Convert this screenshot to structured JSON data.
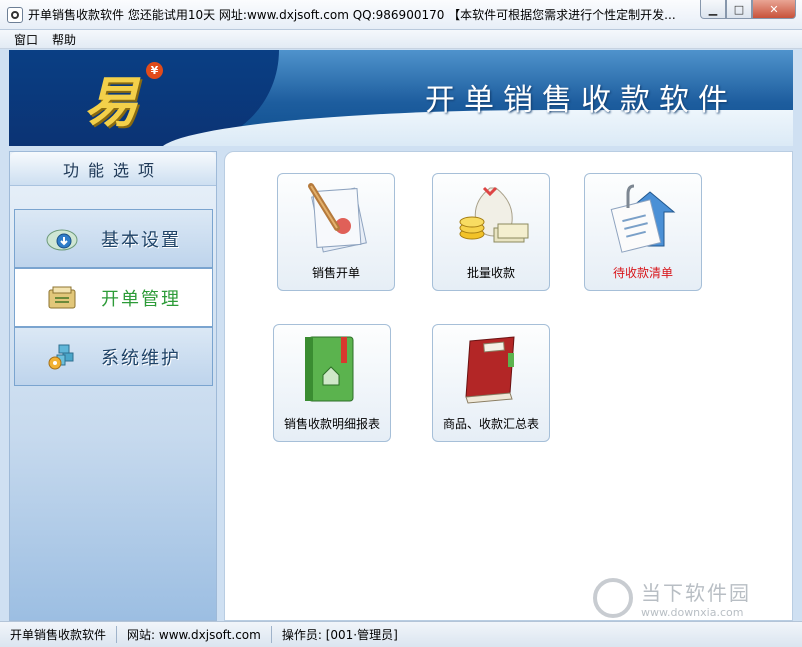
{
  "window": {
    "title": "开单销售收款软件  您还能试用10天   网址:www.dxjsoft.com   QQ:986900170   【本软件可根据您需求进行个性定制开发...",
    "minimize_symbol": "▁",
    "maximize_symbol": "□",
    "close_symbol": "✕"
  },
  "menu": [
    "窗口",
    "帮助"
  ],
  "banner": {
    "logo_text": "易",
    "logo_badge": "¥",
    "title": "开单销售收款软件"
  },
  "sidebar": {
    "header": "功能选项",
    "items": [
      {
        "label": "基本设置",
        "icon": "basic-settings-icon",
        "active": false
      },
      {
        "label": "开单管理",
        "icon": "order-management-icon",
        "active": true
      },
      {
        "label": "系统维护",
        "icon": "system-maintenance-icon",
        "active": false
      }
    ]
  },
  "main": {
    "tiles": [
      {
        "label": "销售开单",
        "icon": "sales-order-icon",
        "highlight": false
      },
      {
        "label": "批量收款",
        "icon": "batch-payment-icon",
        "highlight": false
      },
      {
        "label": "待收款清单",
        "icon": "pending-payment-list-icon",
        "highlight": true
      },
      {
        "label": "销售收款明细报表",
        "icon": "sales-payment-report-icon",
        "highlight": false
      },
      {
        "label": "商品、收款汇总表",
        "icon": "summary-book-icon",
        "highlight": false
      }
    ]
  },
  "statusbar": {
    "app_name": "开单销售收款软件",
    "website": "网站: www.dxjsoft.com",
    "operator": "操作员: [001·管理员]"
  },
  "watermark": {
    "text": "当下软件园",
    "url": "www.downxia.com"
  },
  "colors": {
    "banner_blue": "#1d5d9e",
    "active_green": "#2d9b38",
    "highlight_red": "#d8161b"
  }
}
